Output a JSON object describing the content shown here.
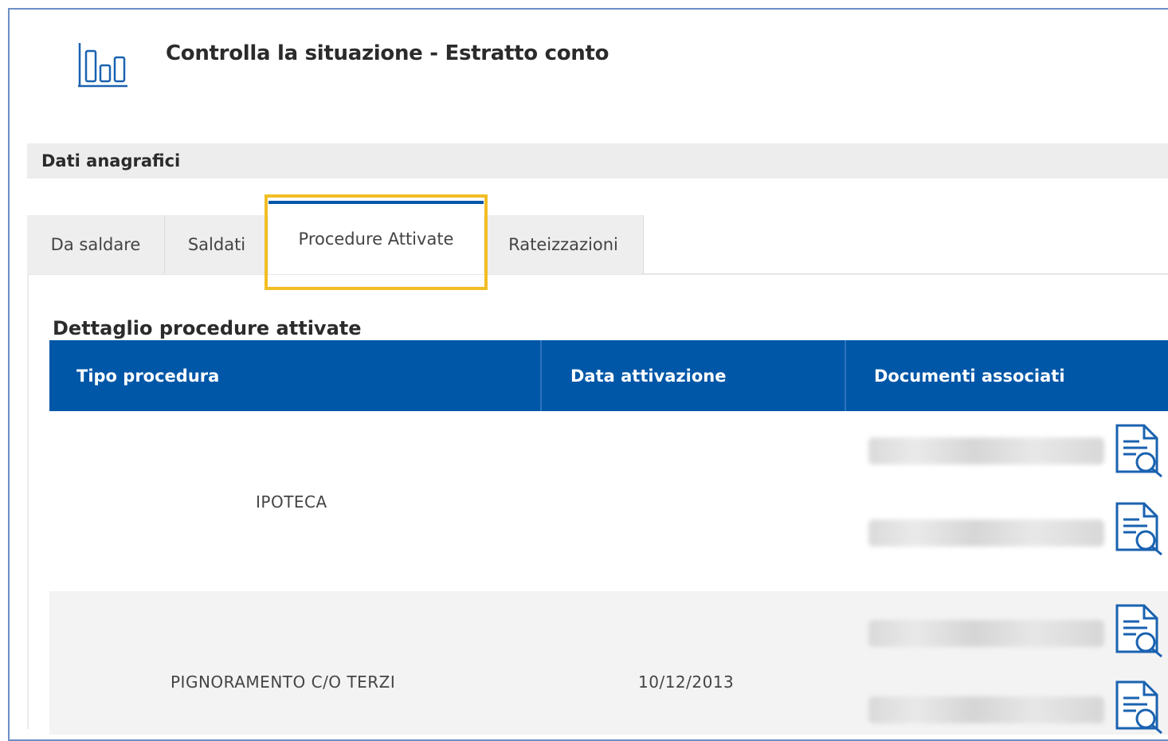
{
  "header": {
    "title": "Controlla la situazione - Estratto conto",
    "icon": "bar-chart-icon"
  },
  "section": {
    "title": "Dati anagrafici"
  },
  "tabs": [
    {
      "label": "Da saldare",
      "active": false
    },
    {
      "label": "Saldati",
      "active": false
    },
    {
      "label": "Procedure Attivate",
      "active": true
    },
    {
      "label": "Rateizzazioni",
      "active": false
    }
  ],
  "detail": {
    "title": "Dettaglio procedure attivate",
    "columns": [
      "Tipo procedura",
      "Data attivazione",
      "Documenti associati"
    ],
    "rows": [
      {
        "tipo": "IPOTECA",
        "data": "",
        "documenti": 2
      },
      {
        "tipo": "PIGNORAMENTO C/O TERZI",
        "data": "10/12/2013",
        "documenti": 2
      }
    ]
  },
  "colors": {
    "primary": "#0057a8",
    "highlight": "#f1be24",
    "section_bg": "#ededed",
    "row_alt": "#f3f3f3"
  },
  "icons": {
    "document": "document-search-icon"
  }
}
